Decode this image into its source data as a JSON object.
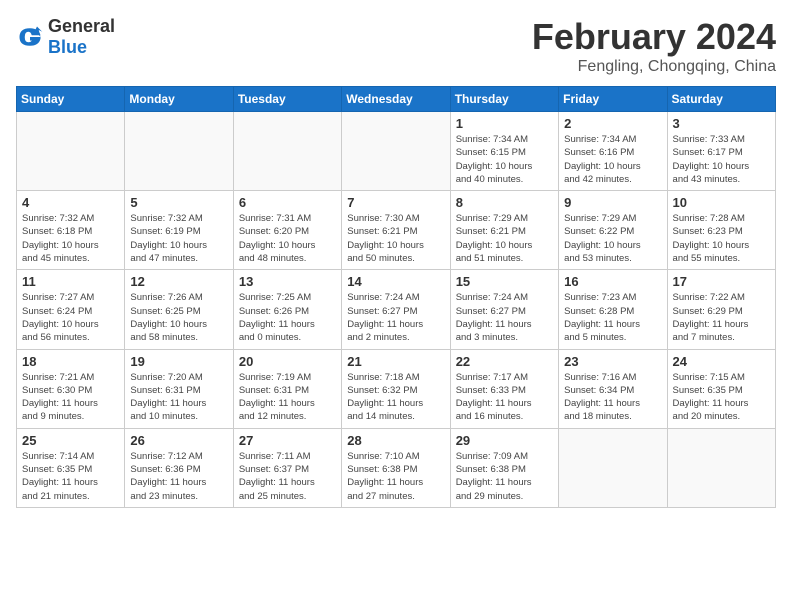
{
  "header": {
    "logo_general": "General",
    "logo_blue": "Blue",
    "month_year": "February 2024",
    "location": "Fengling, Chongqing, China"
  },
  "weekdays": [
    "Sunday",
    "Monday",
    "Tuesday",
    "Wednesday",
    "Thursday",
    "Friday",
    "Saturday"
  ],
  "weeks": [
    [
      {
        "day": "",
        "info": ""
      },
      {
        "day": "",
        "info": ""
      },
      {
        "day": "",
        "info": ""
      },
      {
        "day": "",
        "info": ""
      },
      {
        "day": "1",
        "info": "Sunrise: 7:34 AM\nSunset: 6:15 PM\nDaylight: 10 hours\nand 40 minutes."
      },
      {
        "day": "2",
        "info": "Sunrise: 7:34 AM\nSunset: 6:16 PM\nDaylight: 10 hours\nand 42 minutes."
      },
      {
        "day": "3",
        "info": "Sunrise: 7:33 AM\nSunset: 6:17 PM\nDaylight: 10 hours\nand 43 minutes."
      }
    ],
    [
      {
        "day": "4",
        "info": "Sunrise: 7:32 AM\nSunset: 6:18 PM\nDaylight: 10 hours\nand 45 minutes."
      },
      {
        "day": "5",
        "info": "Sunrise: 7:32 AM\nSunset: 6:19 PM\nDaylight: 10 hours\nand 47 minutes."
      },
      {
        "day": "6",
        "info": "Sunrise: 7:31 AM\nSunset: 6:20 PM\nDaylight: 10 hours\nand 48 minutes."
      },
      {
        "day": "7",
        "info": "Sunrise: 7:30 AM\nSunset: 6:21 PM\nDaylight: 10 hours\nand 50 minutes."
      },
      {
        "day": "8",
        "info": "Sunrise: 7:29 AM\nSunset: 6:21 PM\nDaylight: 10 hours\nand 51 minutes."
      },
      {
        "day": "9",
        "info": "Sunrise: 7:29 AM\nSunset: 6:22 PM\nDaylight: 10 hours\nand 53 minutes."
      },
      {
        "day": "10",
        "info": "Sunrise: 7:28 AM\nSunset: 6:23 PM\nDaylight: 10 hours\nand 55 minutes."
      }
    ],
    [
      {
        "day": "11",
        "info": "Sunrise: 7:27 AM\nSunset: 6:24 PM\nDaylight: 10 hours\nand 56 minutes."
      },
      {
        "day": "12",
        "info": "Sunrise: 7:26 AM\nSunset: 6:25 PM\nDaylight: 10 hours\nand 58 minutes."
      },
      {
        "day": "13",
        "info": "Sunrise: 7:25 AM\nSunset: 6:26 PM\nDaylight: 11 hours\nand 0 minutes."
      },
      {
        "day": "14",
        "info": "Sunrise: 7:24 AM\nSunset: 6:27 PM\nDaylight: 11 hours\nand 2 minutes."
      },
      {
        "day": "15",
        "info": "Sunrise: 7:24 AM\nSunset: 6:27 PM\nDaylight: 11 hours\nand 3 minutes."
      },
      {
        "day": "16",
        "info": "Sunrise: 7:23 AM\nSunset: 6:28 PM\nDaylight: 11 hours\nand 5 minutes."
      },
      {
        "day": "17",
        "info": "Sunrise: 7:22 AM\nSunset: 6:29 PM\nDaylight: 11 hours\nand 7 minutes."
      }
    ],
    [
      {
        "day": "18",
        "info": "Sunrise: 7:21 AM\nSunset: 6:30 PM\nDaylight: 11 hours\nand 9 minutes."
      },
      {
        "day": "19",
        "info": "Sunrise: 7:20 AM\nSunset: 6:31 PM\nDaylight: 11 hours\nand 10 minutes."
      },
      {
        "day": "20",
        "info": "Sunrise: 7:19 AM\nSunset: 6:31 PM\nDaylight: 11 hours\nand 12 minutes."
      },
      {
        "day": "21",
        "info": "Sunrise: 7:18 AM\nSunset: 6:32 PM\nDaylight: 11 hours\nand 14 minutes."
      },
      {
        "day": "22",
        "info": "Sunrise: 7:17 AM\nSunset: 6:33 PM\nDaylight: 11 hours\nand 16 minutes."
      },
      {
        "day": "23",
        "info": "Sunrise: 7:16 AM\nSunset: 6:34 PM\nDaylight: 11 hours\nand 18 minutes."
      },
      {
        "day": "24",
        "info": "Sunrise: 7:15 AM\nSunset: 6:35 PM\nDaylight: 11 hours\nand 20 minutes."
      }
    ],
    [
      {
        "day": "25",
        "info": "Sunrise: 7:14 AM\nSunset: 6:35 PM\nDaylight: 11 hours\nand 21 minutes."
      },
      {
        "day": "26",
        "info": "Sunrise: 7:12 AM\nSunset: 6:36 PM\nDaylight: 11 hours\nand 23 minutes."
      },
      {
        "day": "27",
        "info": "Sunrise: 7:11 AM\nSunset: 6:37 PM\nDaylight: 11 hours\nand 25 minutes."
      },
      {
        "day": "28",
        "info": "Sunrise: 7:10 AM\nSunset: 6:38 PM\nDaylight: 11 hours\nand 27 minutes."
      },
      {
        "day": "29",
        "info": "Sunrise: 7:09 AM\nSunset: 6:38 PM\nDaylight: 11 hours\nand 29 minutes."
      },
      {
        "day": "",
        "info": ""
      },
      {
        "day": "",
        "info": ""
      }
    ]
  ]
}
